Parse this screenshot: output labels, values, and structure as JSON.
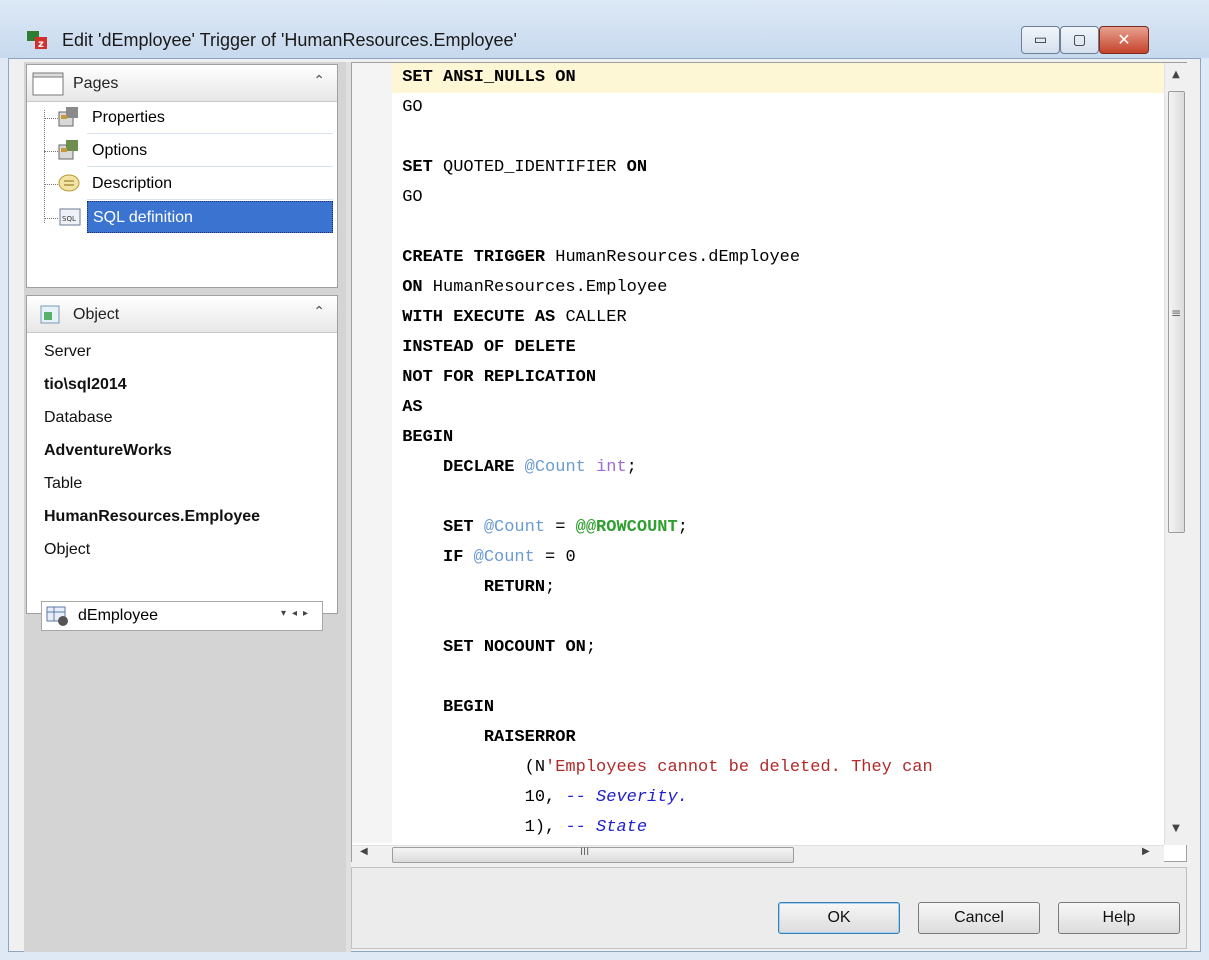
{
  "window": {
    "title": "Edit 'dEmployee' Trigger of 'HumanResources.Employee'",
    "controls": {
      "minimize": "▭",
      "maximize": "▢",
      "close": "✕"
    }
  },
  "pages_panel": {
    "title": "Pages",
    "items": [
      {
        "label": "Properties",
        "icon": "properties-icon"
      },
      {
        "label": "Options",
        "icon": "options-icon"
      },
      {
        "label": "Description",
        "icon": "description-icon"
      },
      {
        "label": "SQL definition",
        "icon": "sql-icon",
        "selected": true
      }
    ]
  },
  "object_panel": {
    "title": "Object",
    "server_label": "Server",
    "server_value": "tio\\sql2014",
    "database_label": "Database",
    "database_value": "AdventureWorks",
    "table_label": "Table",
    "table_value": "HumanResources.Employee",
    "object_label": "Object",
    "object_selected": "dEmployee"
  },
  "editor": {
    "lines": [
      "SET ANSI_NULLS ON",
      "GO",
      "",
      "SET QUOTED_IDENTIFIER ON",
      "GO",
      "",
      "CREATE TRIGGER HumanResources.dEmployee",
      "ON HumanResources.Employee",
      "WITH EXECUTE AS CALLER",
      "INSTEAD OF DELETE",
      "NOT FOR REPLICATION",
      "AS",
      "BEGIN",
      "    DECLARE @Count int;",
      "",
      "    SET @Count = @@ROWCOUNT;",
      "    IF @Count = 0",
      "        RETURN;",
      "",
      "    SET NOCOUNT ON;",
      "",
      "    BEGIN",
      "        RAISERROR",
      "            (N'Employees cannot be deleted. They can ",
      "            10, -- Severity.",
      "            1), -- State"
    ]
  },
  "buttons": {
    "ok": "OK",
    "cancel": "Cancel",
    "help": "Help"
  },
  "colors": {
    "selection": "#3a73d0",
    "current_line": "#fdf7d6",
    "variable": "#6b9bd1",
    "string": "#b02a2a",
    "comment": "#2020cc"
  }
}
